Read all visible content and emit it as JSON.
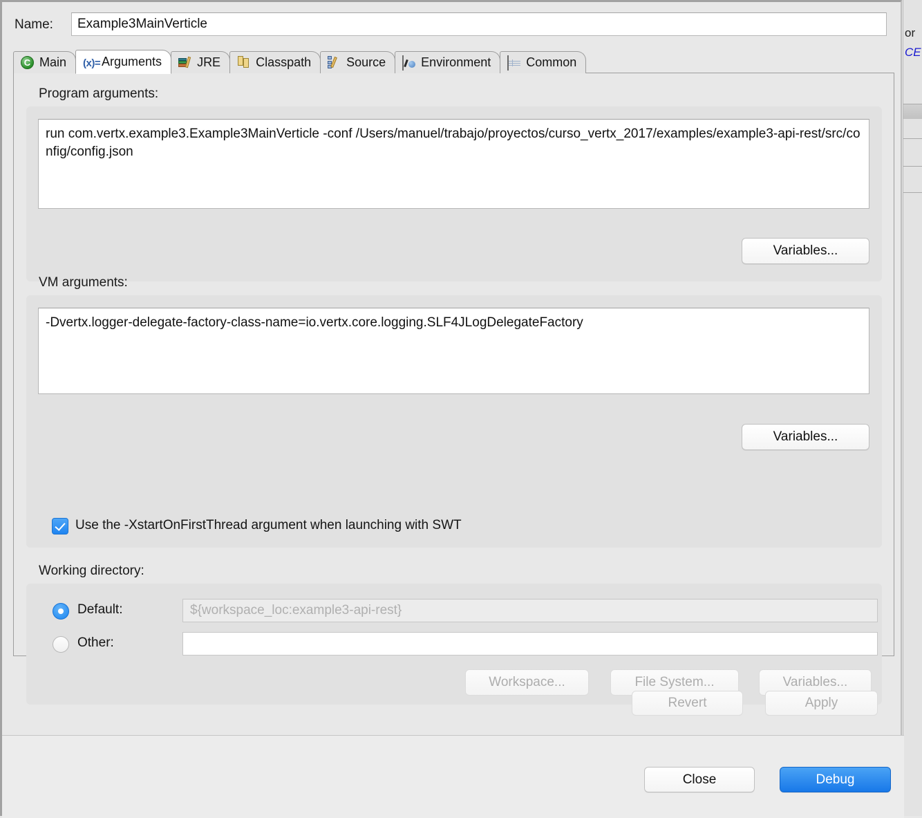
{
  "dialog": {
    "name_label": "Name:",
    "name_value": "Example3MainVerticle"
  },
  "tabs": [
    {
      "label": "Main",
      "icon": "java-class-icon",
      "selected": false
    },
    {
      "label": "Arguments",
      "icon": "variable-icon",
      "selected": true
    },
    {
      "label": "JRE",
      "icon": "jre-books-icon",
      "selected": false
    },
    {
      "label": "Classpath",
      "icon": "classpath-icon",
      "selected": false
    },
    {
      "label": "Source",
      "icon": "source-edit-icon",
      "selected": false
    },
    {
      "label": "Environment",
      "icon": "environment-icon",
      "selected": false
    },
    {
      "label": "Common",
      "icon": "common-table-icon",
      "selected": false
    }
  ],
  "program_arguments": {
    "label": "Program arguments:",
    "value": "run com.vertx.example3.Example3MainVerticle -conf /Users/manuel/trabajo/proyectos/curso_vertx_2017/examples/example3-api-rest/src/config/config.json",
    "variables_button": "Variables..."
  },
  "vm_arguments": {
    "label": "VM arguments:",
    "value": "-Dvertx.logger-delegate-factory-class-name=io.vertx.core.logging.SLF4JLogDelegateFactory",
    "variables_button": "Variables..."
  },
  "swt_option": {
    "label": "Use the -XstartOnFirstThread argument when launching with SWT",
    "checked": true
  },
  "working_directory": {
    "label": "Working directory:",
    "default_radio_label": "Default:",
    "default_value": "${workspace_loc:example3-api-rest}",
    "default_selected": true,
    "other_radio_label": "Other:",
    "other_value": "",
    "other_selected": false,
    "workspace_button": "Workspace...",
    "file_system_button": "File System...",
    "variables_button": "Variables..."
  },
  "actions": {
    "revert": "Revert",
    "apply": "Apply",
    "close": "Close",
    "debug": "Debug"
  },
  "background_window": {
    "text_dark": "or",
    "text_link": "CE"
  },
  "colors": {
    "accent_blue": "#1878e8",
    "checkbox_blue": "#1f84f0",
    "dialog_bg": "#e8e8e8",
    "group_bg": "#e1e1e1",
    "link_blue": "#1a1ad0"
  }
}
